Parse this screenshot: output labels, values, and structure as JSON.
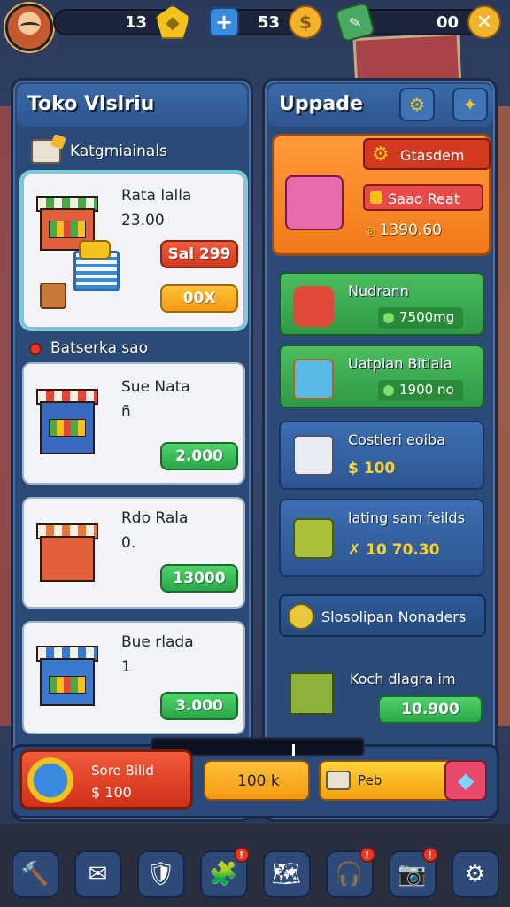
{
  "topbar": {
    "resource_1": {
      "value": "13",
      "icon": "gem-icon"
    },
    "resource_2": {
      "value": "53",
      "icon": "coin-icon"
    },
    "resource_3": {
      "value": "00",
      "icon": "close-icon"
    }
  },
  "left_panel": {
    "title": "Toko Vlslriu",
    "category_label": "Katgmiainals",
    "section_label": "Batserka sao",
    "cards": [
      {
        "name": "Rata lalla",
        "sub": "23.00",
        "btn_primary": "Sal 299",
        "btn_secondary": "00X"
      },
      {
        "name": "Sue Nata",
        "sub": "ñ",
        "btn_primary": "2.000"
      },
      {
        "name": "Rdo Rala",
        "sub": "0.",
        "btn_primary": "13000"
      },
      {
        "name": "Bue rlada",
        "sub": "1",
        "btn_primary": "3.000"
      }
    ]
  },
  "right_panel": {
    "title": "Uppade",
    "featured": {
      "tag": "Gtasdem",
      "sale": "Saao Reat",
      "price": "1390.60"
    },
    "upgrades": [
      {
        "name": "Nudrann",
        "price": "7500mg",
        "style": "green"
      },
      {
        "name": "Uatpian Bitlala",
        "price": "1900 no",
        "style": "green"
      },
      {
        "name": "Costleri eoiba",
        "price": "$ 100",
        "style": "blue"
      },
      {
        "name": "lating sam feilds",
        "price": "✗ 10 70.30",
        "style": "blue"
      }
    ],
    "banner": "Slosolipan Nonaders",
    "last_item": {
      "name": "Koch dlagra im",
      "price": "10.900"
    }
  },
  "action_bar": {
    "build_name": "Sore Bilid",
    "build_price": "$ 100",
    "mid_button": "100 k",
    "right_button": "Peb"
  },
  "nav": {
    "items": [
      {
        "icon": "hammer-icon",
        "glyph": "🔨",
        "badge": ""
      },
      {
        "icon": "mail-icon",
        "glyph": "✉",
        "badge": ""
      },
      {
        "icon": "shield-icon",
        "glyph": "🛡",
        "badge": ""
      },
      {
        "icon": "puzzle-icon",
        "glyph": "🧩",
        "badge": "!"
      },
      {
        "icon": "map-icon",
        "glyph": "🗺",
        "badge": ""
      },
      {
        "icon": "headphones-icon",
        "glyph": "🎧",
        "badge": "!"
      },
      {
        "icon": "camera-icon",
        "glyph": "📷",
        "badge": "!"
      },
      {
        "icon": "gear-icon",
        "glyph": "⚙",
        "badge": ""
      }
    ]
  },
  "colors": {
    "accent_red": "#d23a20",
    "accent_orange": "#f59b10",
    "accent_green": "#2aa748",
    "panel_blue": "#2c4a78"
  }
}
